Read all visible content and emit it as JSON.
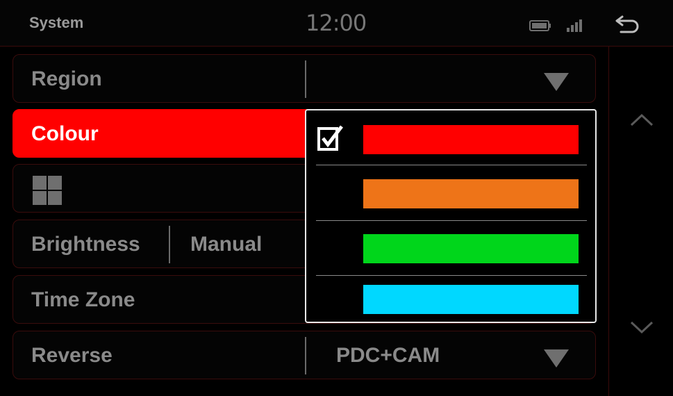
{
  "header": {
    "title": "System",
    "clock": "12:00",
    "icons": [
      "battery-icon",
      "signal-icon",
      "back-icon"
    ]
  },
  "settings": {
    "region": {
      "label": "Region",
      "value": ""
    },
    "colour": {
      "label": "Colour",
      "selected_index": 0
    },
    "theme": {
      "icon": "grid-icon"
    },
    "brightness": {
      "label": "Brightness",
      "value": "Manual"
    },
    "time_zone": {
      "label": "Time Zone"
    },
    "reverse": {
      "label": "Reverse",
      "value": "PDC+CAM"
    }
  },
  "colour_options": [
    {
      "color": "#ff0000",
      "checked": true
    },
    {
      "color": "#ee7418",
      "checked": false
    },
    {
      "color": "#00d61b",
      "checked": false
    },
    {
      "color": "#00d8ff",
      "checked": false
    }
  ],
  "colors": {
    "accent": "#ff0000",
    "border": "#3a0c0c",
    "text": "#8a8a8a"
  }
}
